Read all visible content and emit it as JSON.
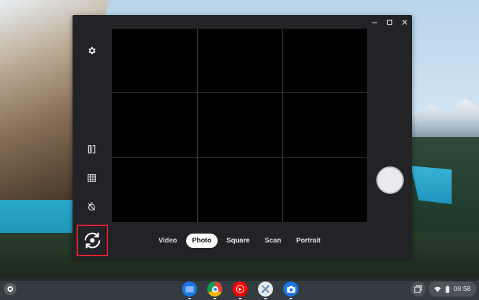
{
  "camera_app": {
    "modes": [
      {
        "label": "Video",
        "selected": false
      },
      {
        "label": "Photo",
        "selected": true
      },
      {
        "label": "Square",
        "selected": false
      },
      {
        "label": "Scan",
        "selected": false
      },
      {
        "label": "Portrait",
        "selected": false
      }
    ],
    "toolbar_icons": [
      "settings-icon",
      "mirror-icon",
      "grid-icon",
      "timer-off-icon",
      "switch-camera-icon"
    ],
    "grid_overlay": "3x3",
    "highlight_color": "#e2222b"
  },
  "shelf": {
    "apps": [
      "files",
      "chrome",
      "youtube-music",
      "linux-terminal",
      "camera"
    ],
    "clock": "08:58"
  }
}
